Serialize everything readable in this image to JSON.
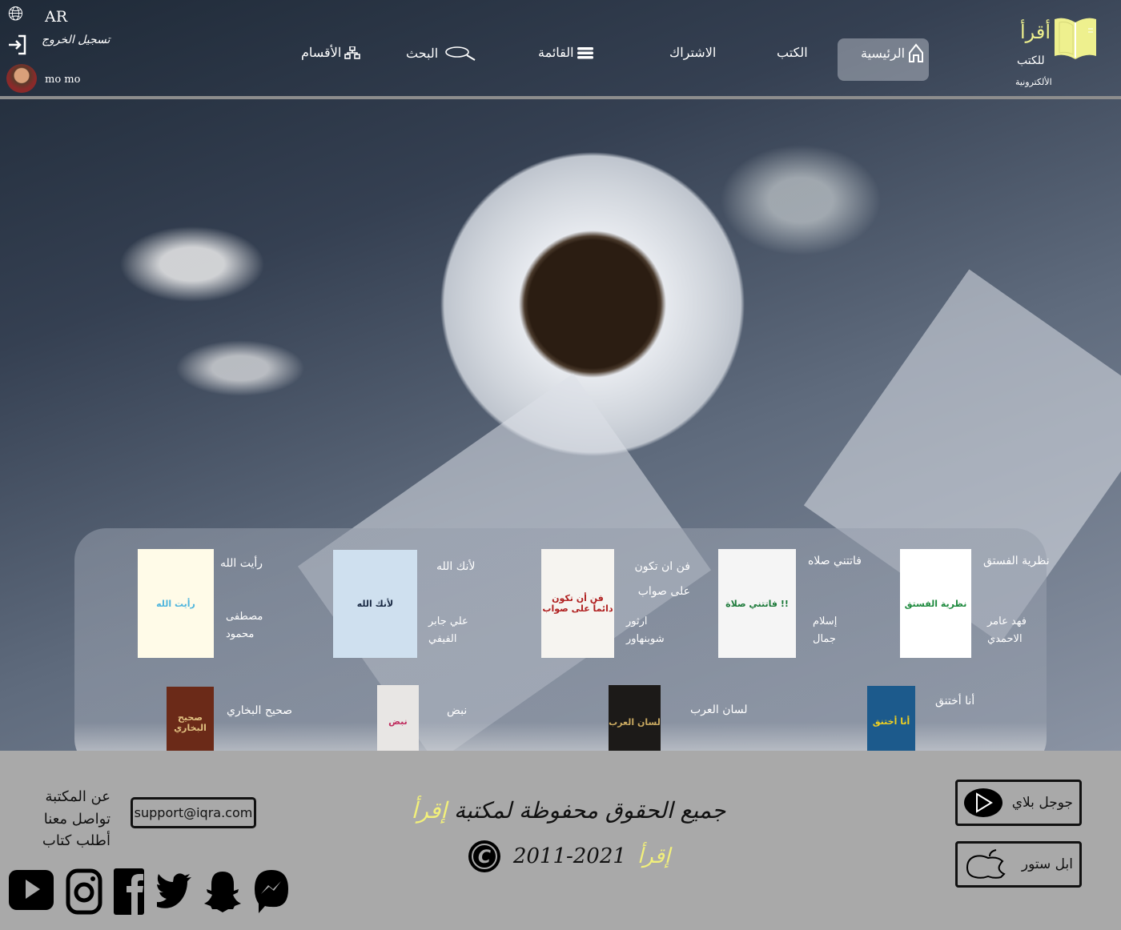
{
  "header": {
    "lang": "AR",
    "logout": "تسجيل الخروج",
    "user": "mo mo",
    "logo": {
      "title": "أقرأ",
      "line1": "للكتب",
      "line2": "الألكترونية",
      "color": "#eef08e"
    },
    "nav": [
      {
        "label": "الرئيسية",
        "icon": "home-icon",
        "active": true
      },
      {
        "label": "الكتب"
      },
      {
        "label": "الاشتراك"
      },
      {
        "label": "القائمة",
        "icon": "menu-icon"
      },
      {
        "label": "البحث",
        "icon": "search-icon"
      },
      {
        "label": "الأقسام",
        "icon": "sitemap-icon"
      }
    ]
  },
  "books": [
    {
      "title": "نظرية الفستق",
      "author": "فهد عامر الاحمدي",
      "cover_text": "نظرية الفستق",
      "cover_color": "#ffffff",
      "cover_ink": "#1e8a3e"
    },
    {
      "title": "فاتتني صلاه",
      "author": "إسلام جمال",
      "cover_text": "فاتتني صلاة !!",
      "cover_color": "#f5f5f5",
      "cover_ink": "#1d7a3a"
    },
    {
      "title": "فن ان تكون على صواب",
      "author": "ارثور شوبنهاور",
      "cover_text": "فن أن تكون دائماً على صواب",
      "cover_color": "#f6f4f0",
      "cover_ink": "#b02020"
    },
    {
      "title": "لأنك الله",
      "author": "علي جابر الفيفي",
      "cover_text": "لأنك الله",
      "cover_color": "#cfe0ef",
      "cover_ink": "#1a2a44"
    },
    {
      "title": "رأيت الله",
      "author": "مصطفى محمود",
      "cover_text": "رأيت الله",
      "cover_color": "#fffbe8",
      "cover_ink": "#4fb5dd"
    },
    {
      "title": "أنا أختنق",
      "cover_text": "أنا أختنق",
      "cover_color": "#1c5a8c",
      "cover_ink": "#f0d020"
    },
    {
      "title": "لسان العرب",
      "cover_text": "لسان العرب",
      "cover_color": "#1c1a18",
      "cover_ink": "#c8a860"
    },
    {
      "title": "نبض",
      "cover_text": "نبض",
      "cover_color": "#e8e6e4",
      "cover_ink": "#c03060"
    },
    {
      "title": "صحيح البخاري",
      "cover_text": "صحيح البخاري",
      "cover_color": "#6b2a18",
      "cover_ink": "#e0c080"
    }
  ],
  "footer": {
    "links": [
      "عن المكتبة",
      "تواصل معنا",
      "أطلب كتاب"
    ],
    "email": "support@iqra.com",
    "social": [
      "youtube-icon",
      "instagram-icon",
      "facebook-icon",
      "twitter-icon",
      "snapchat-icon",
      "messenger-icon"
    ],
    "copyright_line": "جميع الحقوق محفوظة لمكتبة",
    "brand": "إقرأ",
    "years": "2011-2021",
    "google_play": "جوجل بلاي",
    "app_store": "ابل ستور"
  }
}
